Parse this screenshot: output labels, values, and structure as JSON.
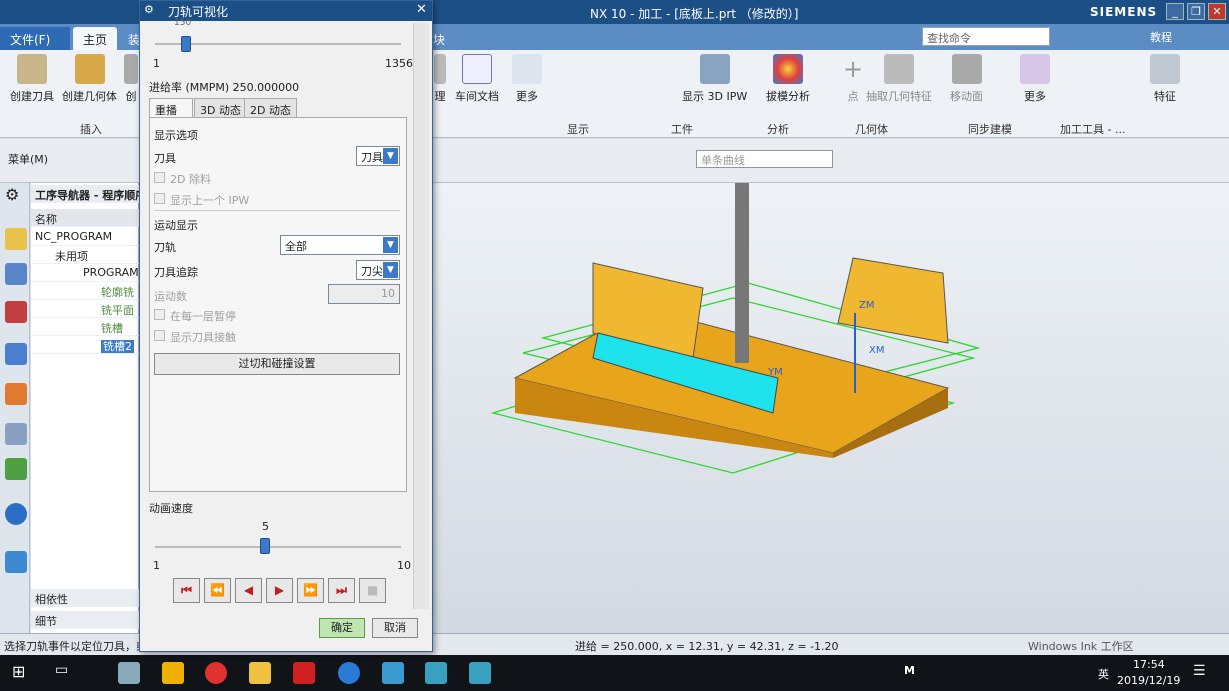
{
  "window": {
    "title": "NX 10 - 加工 - [底板上.prt （修改的）]",
    "brand": "SIEMENS",
    "help": "教程"
  },
  "tabs": {
    "file": "文件(F)",
    "home": "主页",
    "partial": "装",
    "partial2": "块"
  },
  "search": {
    "placeholder": "查找命令"
  },
  "ribbon": {
    "create_tool": "创建刀具",
    "create_geometry": "创建几何体",
    "create_partial": "创",
    "process_partial": "理",
    "shop_doc": "车间文档",
    "more1": "更多",
    "show_ipw": "显示 3D IPW",
    "draft_analysis": "拔模分析",
    "point": "点",
    "extract_geometry": "抽取几何特征",
    "move_face": "移动面",
    "more2": "更多",
    "feature": "特征",
    "groups": {
      "insert": "插入",
      "display": "显示",
      "workpiece": "工件",
      "analysis": "分析",
      "geometry": "几何体",
      "sync_modeling": "同步建模",
      "machining_tools": "加工工具 - ..."
    }
  },
  "toolbar": {
    "menu": "菜单(M)",
    "curve_filter": "单条曲线"
  },
  "navigator": {
    "title": "工序导航器 - 程序顺序",
    "col_name": "名称",
    "rows": [
      "NC_PROGRAM",
      "未用项",
      "PROGRAM",
      "轮廓铣",
      "铣平面",
      "铣槽",
      "铣槽2"
    ],
    "dependency": "相依性",
    "details": "细节"
  },
  "dialog": {
    "title": "刀轨可视化",
    "top_max": "1356",
    "top_min": "1",
    "top_value": "150",
    "feed_rate": "进给率 (MMPM) 250.000000",
    "tabs": [
      "重播",
      "3D 动态",
      "2D 动态"
    ],
    "display_options": "显示选项",
    "tool_label": "刀具",
    "tool_value": "刀具",
    "chk_2d_remove": "2D 除料",
    "chk_show_prev_ipw": "显示上一个 IPW",
    "motion_display": "运动显示",
    "toolpath_label": "刀轨",
    "toolpath_value": "全部",
    "tool_trace_label": "刀具追踪",
    "tool_trace_value": "刀尖",
    "motion_count_label": "运动数",
    "motion_count_value": "10",
    "chk_pause_each_layer": "在每一层暂停",
    "chk_show_tool_contact": "显示刀具接触",
    "overcut_btn": "过切和碰撞设置",
    "anim_speed": "动画速度",
    "speed_value": "5",
    "speed_min": "1",
    "speed_max": "10",
    "ok": "确定",
    "cancel": "取消"
  },
  "status": {
    "hint": "选择刀轨事件以定位刀具，或",
    "coords": "进给 = 250.000, x = 12.31, y = 42.31, z = -1.20",
    "ink": "Windows Ink 工作区"
  },
  "taskbar": {
    "lang": "英",
    "time": "17:54",
    "date": "2019/12/19",
    "m": "M"
  },
  "viewport": {
    "zm": "ZM",
    "ym": "YM",
    "xm": "XM"
  }
}
